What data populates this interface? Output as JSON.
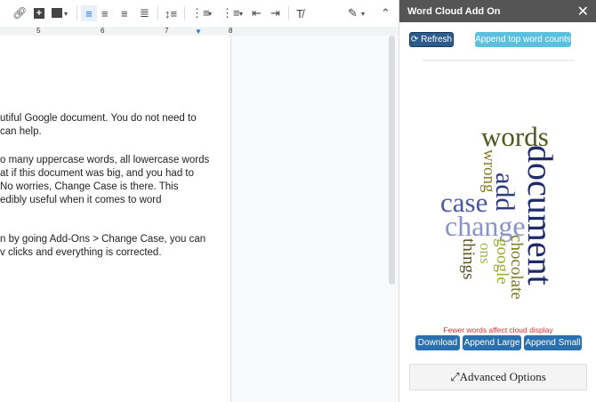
{
  "toolbar": {
    "icons": [
      "link-icon",
      "add-comment-icon",
      "insert-image-icon",
      "align-left-icon",
      "align-center-icon",
      "align-right-icon",
      "justify-icon",
      "line-spacing-icon",
      "numbered-list-icon",
      "bulleted-list-icon",
      "decrease-indent-icon",
      "increase-indent-icon",
      "clear-formatting-icon",
      "edit-mode-icon",
      "collapse-icon"
    ]
  },
  "ruler": {
    "marks": [
      "5",
      "6",
      "7",
      "8"
    ]
  },
  "document": {
    "lines": [
      "utiful Google document. You do not need to",
      "can help.",
      "o many uppercase words, all lowercase words",
      "at if this document was big, and you had to",
      " No worries, Change Case is there. This",
      "edibly useful when it comes to word",
      "n by going Add-Ons > Change Case, you can",
      "v clicks and everything is corrected."
    ]
  },
  "panel": {
    "title": "Word Cloud Add On",
    "close": "✕",
    "refresh_label": "⟳ Refresh",
    "append_counts_label": "Append top word counts",
    "warning": "Fewer words affect cloud display",
    "download_label": "Download",
    "append_large_label": "Append Large",
    "append_small_label": "Append Small",
    "advanced_label": "Advanced Options",
    "advanced_icon": "⤢",
    "colors": {
      "header": "#555555",
      "primary": "#2a6fae",
      "info": "#5bc0de",
      "warning": "#e03030"
    }
  },
  "word_cloud": {
    "words": [
      "words",
      "document",
      "wrong",
      "add",
      "case",
      "change",
      "things",
      "ons",
      "google",
      "chocolate"
    ]
  }
}
